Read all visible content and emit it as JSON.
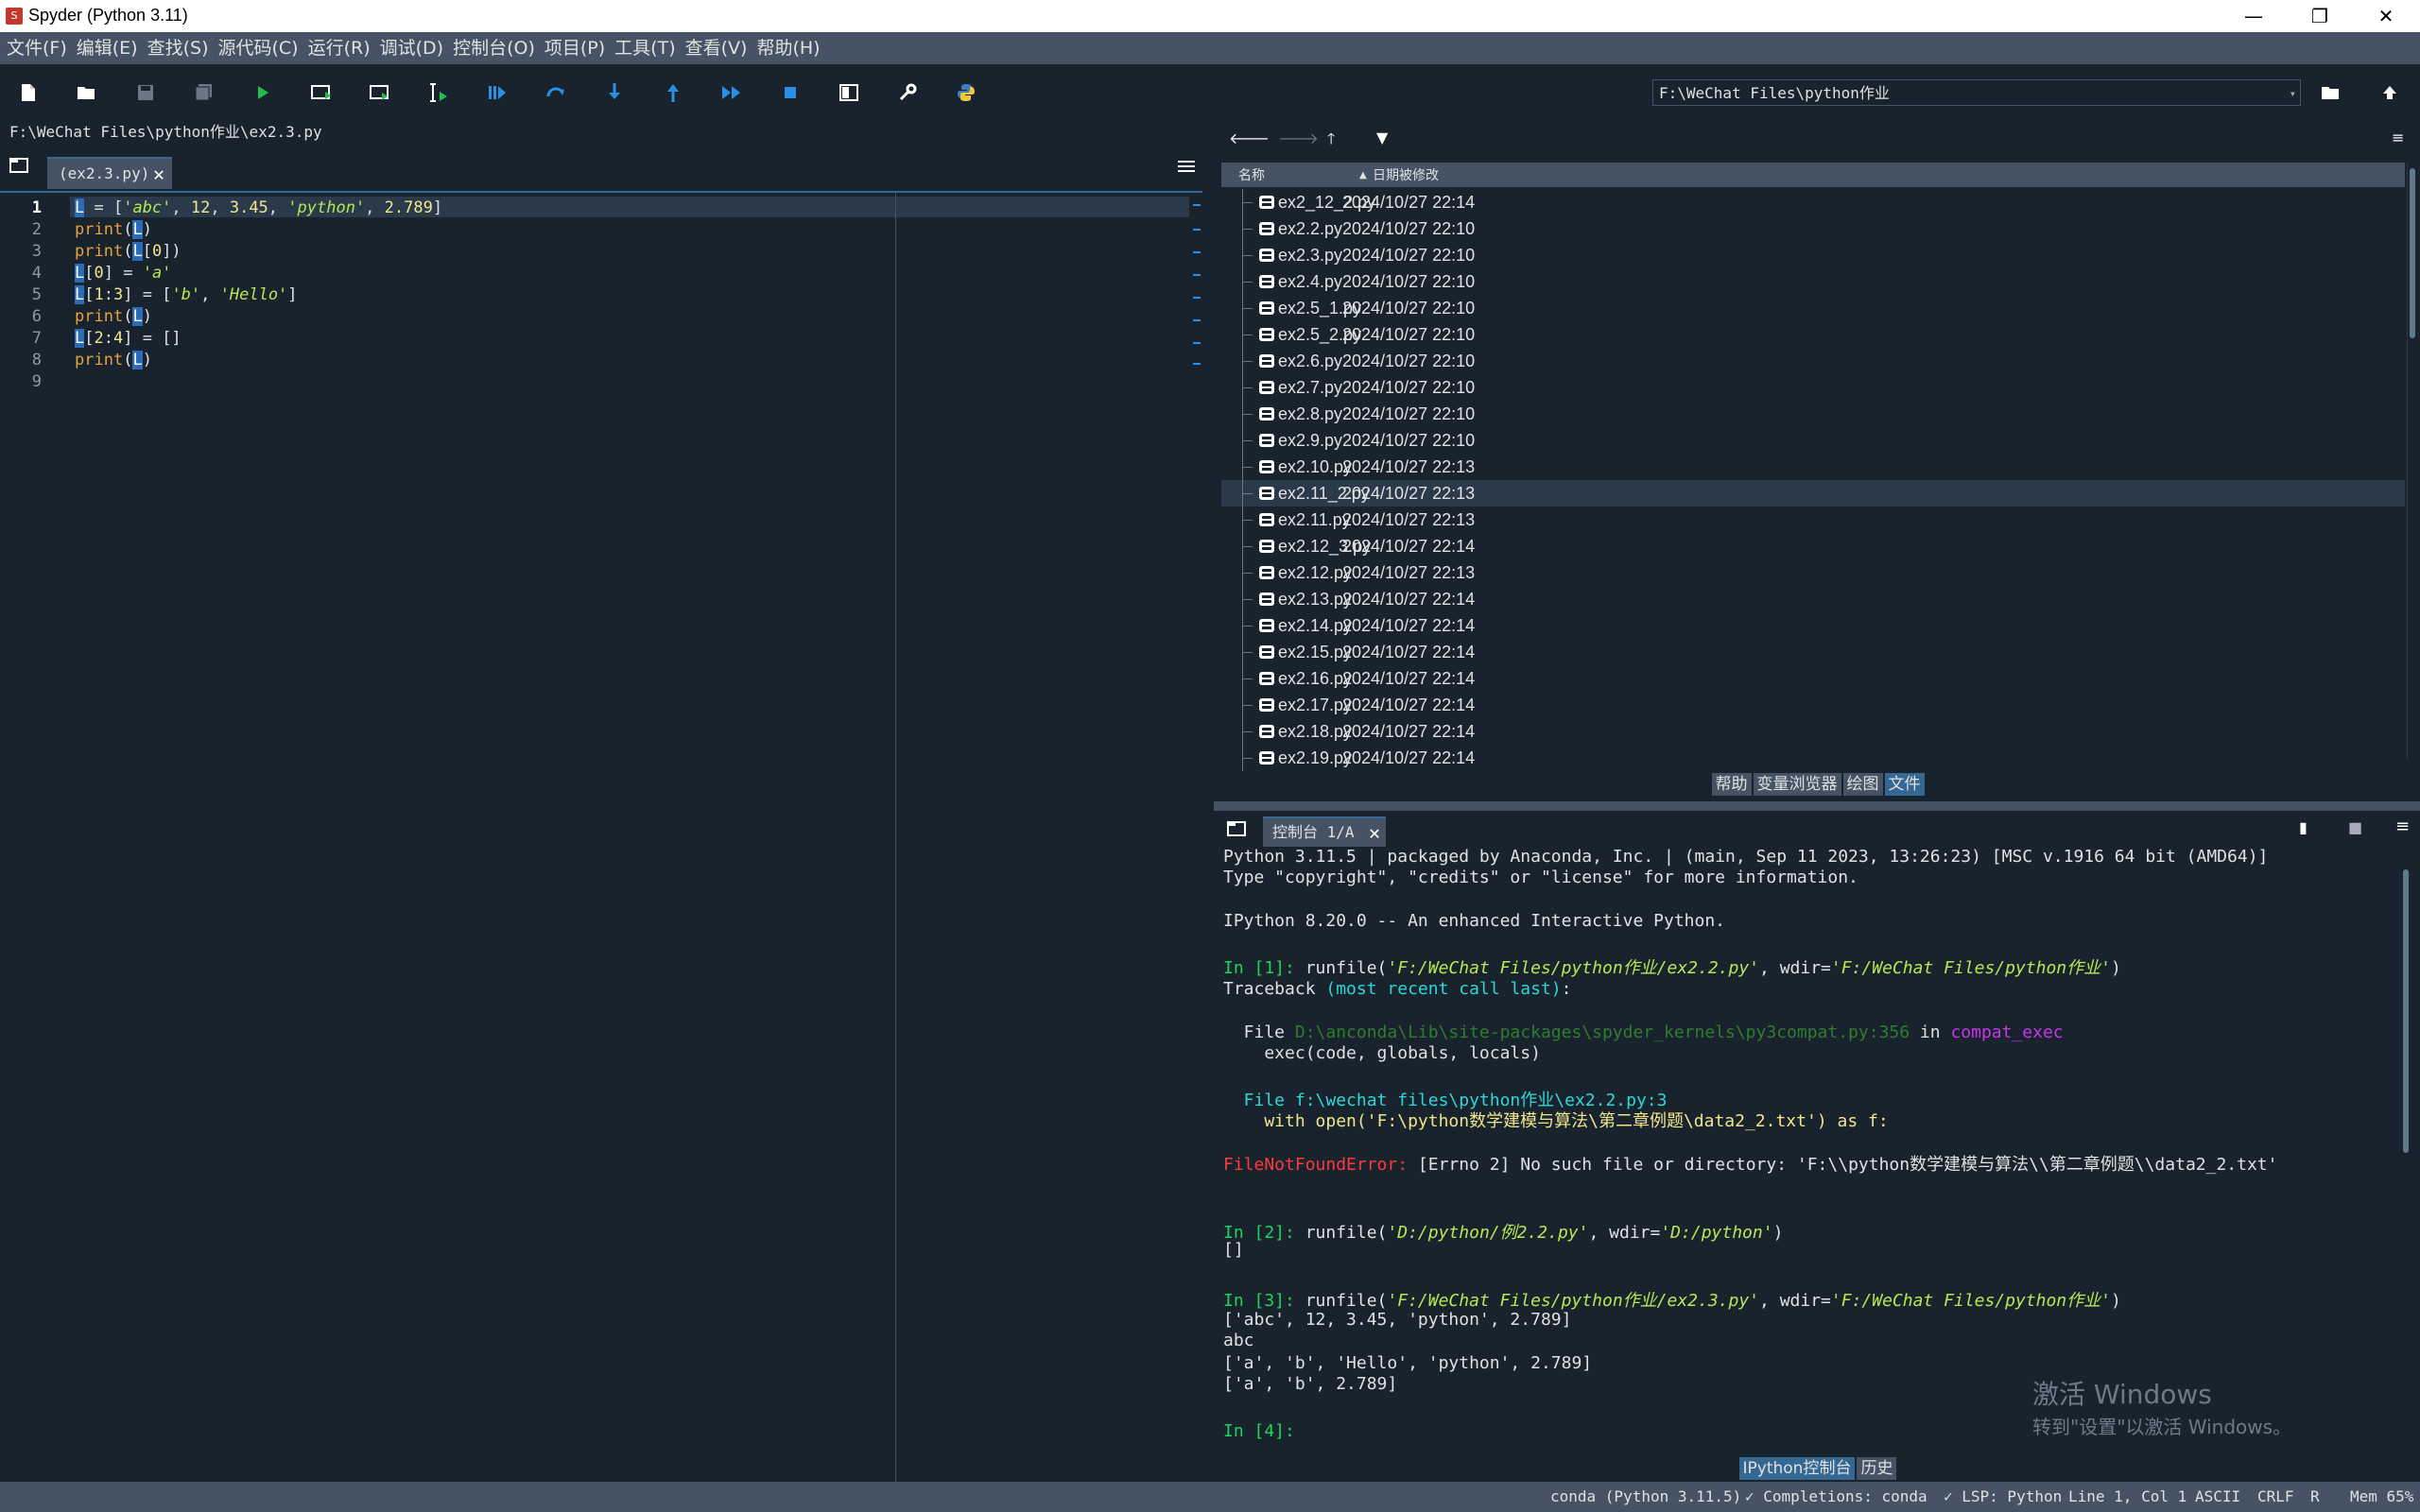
{
  "window": {
    "title": "Spyder (Python 3.11)",
    "logo": "S",
    "minimize": "—",
    "restore": "❐",
    "close": "✕"
  },
  "menu": [
    "文件(F)",
    "编辑(E)",
    "查找(S)",
    "源代码(C)",
    "运行(R)",
    "调试(D)",
    "控制台(O)",
    "项目(P)",
    "工具(T)",
    "查看(V)",
    "帮助(H)"
  ],
  "toolbar": {
    "icons": [
      "new-file-icon",
      "open-file-icon",
      "save-icon",
      "save-all-icon",
      "run-icon",
      "run-cell-icon",
      "run-cell-advance-icon",
      "run-selection-icon",
      "debug-icon",
      "step-icon",
      "step-into-icon",
      "step-return-icon",
      "continue-icon",
      "stop-icon",
      "maximize-pane-icon",
      "preferences-icon",
      "python-path-icon"
    ],
    "working_dir": "F:\\WeChat Files\\python作业"
  },
  "editor": {
    "file_path": "F:\\WeChat Files\\python作业\\ex2.3.py",
    "tab_label": "(ex2.3.py)",
    "line_numbers": [
      "1",
      "2",
      "3",
      "4",
      "5",
      "6",
      "7",
      "8",
      "9"
    ],
    "current_line": 1
  },
  "explorer": {
    "col_name": "名称",
    "col_date": "日期被修改",
    "files": [
      {
        "name": "ex2_12_2.py",
        "date": "2024/10/27 22:14"
      },
      {
        "name": "ex2.2.py",
        "date": "2024/10/27 22:10"
      },
      {
        "name": "ex2.3.py",
        "date": "2024/10/27 22:10"
      },
      {
        "name": "ex2.4.py",
        "date": "2024/10/27 22:10"
      },
      {
        "name": "ex2.5_1.py",
        "date": "2024/10/27 22:10"
      },
      {
        "name": "ex2.5_2.py",
        "date": "2024/10/27 22:10"
      },
      {
        "name": "ex2.6.py",
        "date": "2024/10/27 22:10"
      },
      {
        "name": "ex2.7.py",
        "date": "2024/10/27 22:10"
      },
      {
        "name": "ex2.8.py",
        "date": "2024/10/27 22:10"
      },
      {
        "name": "ex2.9.py",
        "date": "2024/10/27 22:10"
      },
      {
        "name": "ex2.10.py",
        "date": "2024/10/27 22:13"
      },
      {
        "name": "ex2.11_2.py",
        "date": "2024/10/27 22:13"
      },
      {
        "name": "ex2.11.py",
        "date": "2024/10/27 22:13"
      },
      {
        "name": "ex2.12_3.py",
        "date": "2024/10/27 22:14"
      },
      {
        "name": "ex2.12.py",
        "date": "2024/10/27 22:13"
      },
      {
        "name": "ex2.13.py",
        "date": "2024/10/27 22:14"
      },
      {
        "name": "ex2.14.py",
        "date": "2024/10/27 22:14"
      },
      {
        "name": "ex2.15.py",
        "date": "2024/10/27 22:14"
      },
      {
        "name": "ex2.16.py",
        "date": "2024/10/27 22:14"
      },
      {
        "name": "ex2.17.py",
        "date": "2024/10/27 22:14"
      },
      {
        "name": "ex2.18.py",
        "date": "2024/10/27 22:14"
      },
      {
        "name": "ex2.19.py",
        "date": "2024/10/27 22:14"
      }
    ],
    "selected_index": 11,
    "pane_tabs": [
      "帮助",
      "变量浏览器",
      "绘图",
      "文件"
    ],
    "active_pane_tab": "文件"
  },
  "console": {
    "tab_label": "控制台 1/A",
    "banner1": "Python 3.11.5 | packaged by Anaconda, Inc. | (main, Sep 11 2023, 13:26:23) [MSC v.1916 64 bit (AMD64)]",
    "banner2": "Type \"copyright\", \"credits\" or \"license\" for more information.",
    "banner3": "IPython 8.20.0 -- An enhanced Interactive Python.",
    "in1_prompt": "In [1]:",
    "in1_cmd_a": "runfile(",
    "in1_arg1": "'F:/WeChat Files/python作业/ex2.2.py'",
    "in1_cmd_b": ", wdir=",
    "in1_arg2": "'F:/WeChat Files/python作业'",
    "in1_cmd_c": ")",
    "tb_head_a": "Traceback ",
    "tb_head_b": "(most recent call last)",
    "tb_head_c": ":",
    "tb1_a": "  File ",
    "tb1_path": "D:\\anconda\\Lib\\site-packages\\spyder_kernels\\py3compat.py:356",
    "tb1_in": " in ",
    "tb1_fn": "compat_exec",
    "tb1_code": "    exec(code, globals, locals)",
    "tb2_a": "  File ",
    "tb2_path": "f:\\wechat files\\python作业\\ex2.2.py:3",
    "tb2_code_a": "    with ",
    "tb2_code_b": "open(",
    "tb2_code_c": "'F:\\python数学建模与算法\\第二章例题\\data2_2.txt'",
    "tb2_code_d": ") ",
    "tb2_code_e": "as",
    "tb2_code_f": " f:",
    "err_name": "FileNotFoundError:",
    "err_msg": " [Errno 2] No such file or directory: 'F:\\\\python数学建模与算法\\\\第二章例题\\\\data2_2.txt'",
    "in2_prompt": "In [2]:",
    "in2_cmd_a": "runfile(",
    "in2_arg1": "'D:/python/例2.2.py'",
    "in2_cmd_b": ", wdir=",
    "in2_arg2": "'D:/python'",
    "in2_cmd_c": ")",
    "out2": "[]",
    "in3_prompt": "In [3]:",
    "in3_cmd_a": "runfile(",
    "in3_arg1": "'F:/WeChat Files/python作业/ex2.3.py'",
    "in3_cmd_b": ", wdir=",
    "in3_arg2": "'F:/WeChat Files/python作业'",
    "in3_cmd_c": ")",
    "out3_1": "['abc', 12, 3.45, 'python', 2.789]",
    "out3_2": "abc",
    "out3_3": "['a', 'b', 'Hello', 'python', 2.789]",
    "out3_4": "['a', 'b', 2.789]",
    "in4_prompt": "In [4]:",
    "pane_tabs": [
      "IPython控制台",
      "历史"
    ],
    "active_pane_tab": "IPython控制台"
  },
  "watermark": {
    "line1": "激活 Windows",
    "line2": "转到\"设置\"以激活 Windows。"
  },
  "status": {
    "env": "conda (Python 3.11.5)",
    "completions": "✓ Completions: conda",
    "lsp": "✓ LSP: Python",
    "position": "Line 1, Col 1",
    "encoding": "ASCII",
    "eol": "CRLF",
    "rw": "R",
    "mem": "Mem 65%"
  },
  "colors": {
    "bg": "#19232d",
    "panel": "#455364",
    "accent": "#346792",
    "prompt": "#1fd45a",
    "error": "#ff3838"
  }
}
